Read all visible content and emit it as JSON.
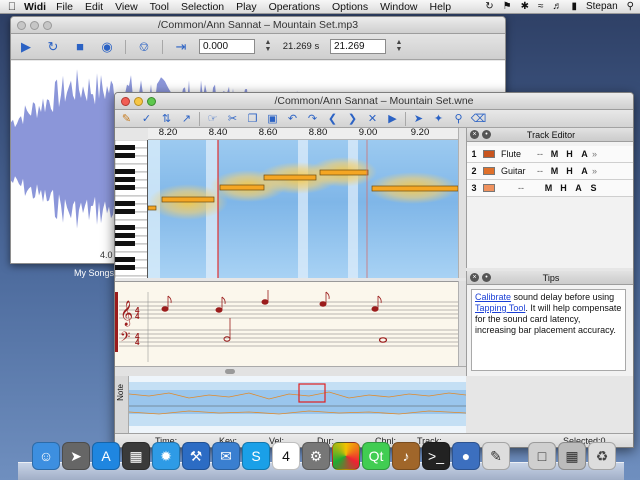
{
  "menubar": {
    "app_name": "Widi",
    "items": [
      "File",
      "Edit",
      "View",
      "Tool",
      "Selection",
      "Play",
      "Operations",
      "Options",
      "Window",
      "Help"
    ],
    "user": "Stepan"
  },
  "audio_window": {
    "title": "/Common/Ann Sannat – Mountain Set.mp3",
    "start_value": "0.000",
    "duration_readout": "21.269 s",
    "end_value": "21.269",
    "wave_time_label": "4.0",
    "dock_label": "My Songs"
  },
  "main_window": {
    "title": "/Common/Ann Sannat – Mountain Set.wne",
    "ruler_ticks": [
      "8.20",
      "8.40",
      "8.60",
      "8.80",
      "9.00",
      "9.20"
    ],
    "status": {
      "time": "Time:",
      "key": "Key:",
      "vel": "Vel:",
      "dur": "Dur:",
      "chnl": "Chnl:",
      "track": "Track:",
      "selected": "Selected:0"
    },
    "overview_label": "Note"
  },
  "track_editor": {
    "title": "Track Editor",
    "tracks": [
      {
        "num": "1",
        "name": "Flute",
        "color": "#c8541e"
      },
      {
        "num": "2",
        "name": "Guitar",
        "color": "#e0702a"
      },
      {
        "num": "3",
        "name": "",
        "color": "#f0925e"
      }
    ],
    "buttons": [
      "M",
      "H",
      "A",
      "S"
    ],
    "dash": "--"
  },
  "tips": {
    "title": "Tips",
    "link1": "Calibrate",
    "text1": " sound delay before using ",
    "link2": "Tapping Tool",
    "text2": ". It will help compensate for the sound card latency, increasing bar placement accuracy."
  },
  "colors": {
    "accent": "#2b62c4",
    "note_fill": "#f5a623",
    "spectrum": "#7fb6e8",
    "waveform": "#8b96d9",
    "playhead": "#e03030",
    "score_notes": "#9b1c1c"
  }
}
